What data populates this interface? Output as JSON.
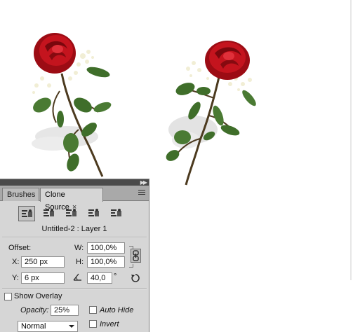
{
  "panel": {
    "tabs": [
      {
        "label": "Brushes"
      },
      {
        "label": "Clone Source"
      }
    ],
    "close_glyph": "×",
    "source_name": "Untitled-2 : Layer 1",
    "offset_label": "Offset:",
    "x_label": "X:",
    "x_value": "250 px",
    "y_label": "Y:",
    "y_value": "6 px",
    "w_label": "W:",
    "w_value": "100,0%",
    "h_label": "H:",
    "h_value": "100,0%",
    "angle_value": "40,0",
    "degree_glyph": "°",
    "show_overlay_label": "Show Overlay",
    "opacity_label": "Opacity:",
    "opacity_value": "25%",
    "auto_hide_label": "Auto Hide",
    "invert_label": "Invert",
    "blend_mode": "Normal"
  },
  "icons": {
    "source_buttons": [
      "clone-source-1-icon",
      "clone-source-2-icon",
      "clone-source-3-icon",
      "clone-source-4-icon",
      "clone-source-5-icon"
    ],
    "link": "chain-link-icon",
    "angle": "angle-icon",
    "reset": "reset-transform-icon"
  },
  "colors": {
    "rose": "#b3101a",
    "leaf": "#3f6e2a",
    "stem": "#4c3a1f",
    "panel_bg": "#d6d6d6",
    "tab_bar": "#a9a9a9"
  }
}
